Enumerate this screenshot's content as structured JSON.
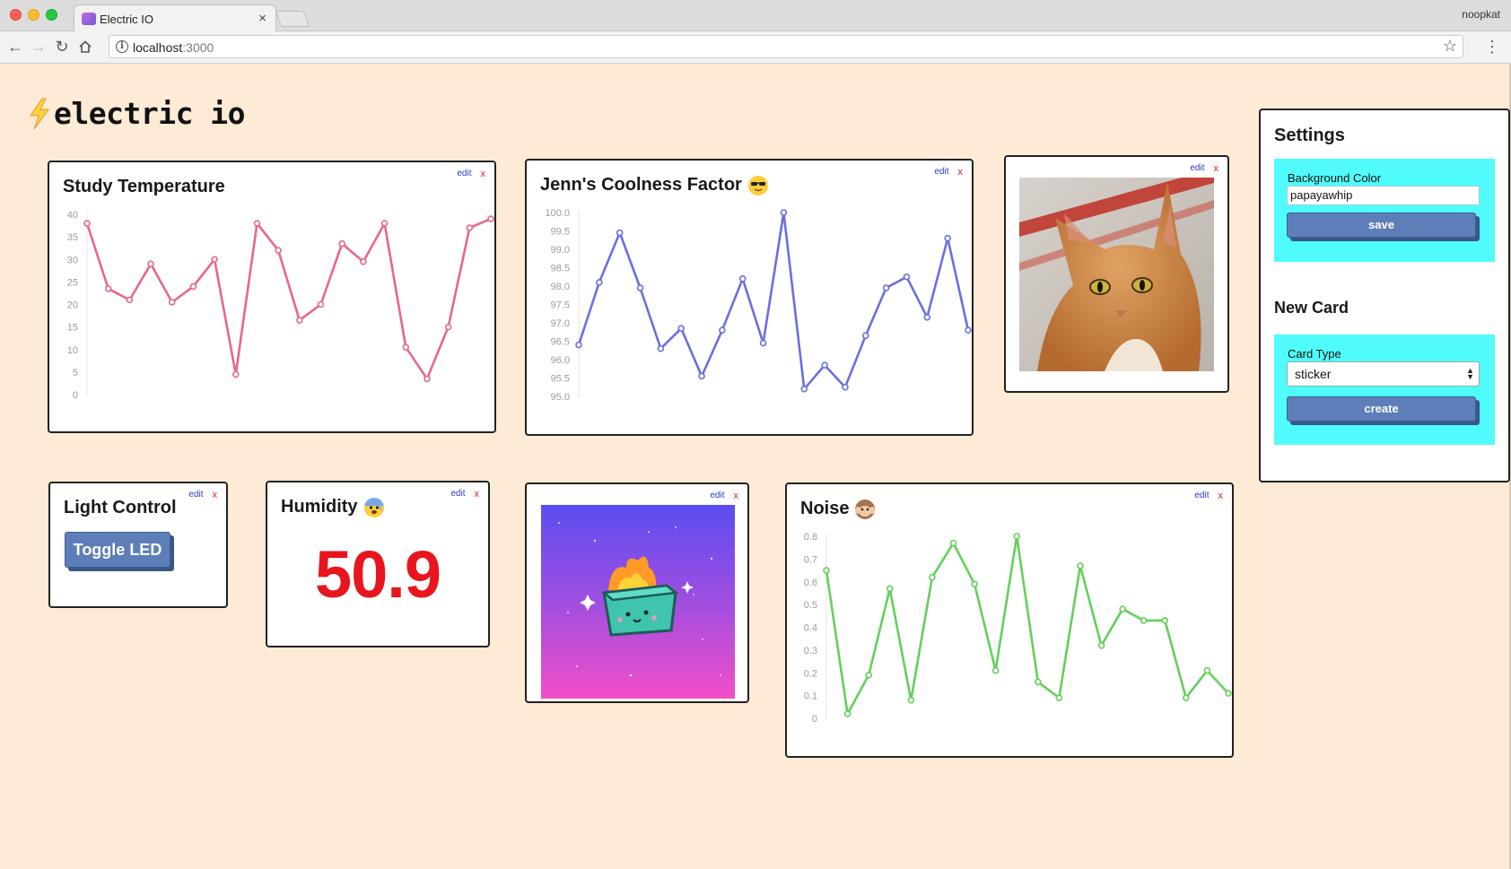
{
  "browser": {
    "tab_title": "Electric IO",
    "profile": "noopkat",
    "url_host": "localhost",
    "url_port": ":3000",
    "tab_close": "×"
  },
  "app": {
    "logo_text": "electric io"
  },
  "card_actions": {
    "edit": "edit",
    "remove": "x"
  },
  "cards": {
    "study_temperature": {
      "title": "Study Temperature"
    },
    "coolness": {
      "title": "Jenn's Coolness Factor"
    },
    "light_control": {
      "title": "Light Control",
      "button": "Toggle LED"
    },
    "humidity": {
      "title": "Humidity",
      "value": "50.9"
    },
    "noise": {
      "title": "Noise"
    }
  },
  "settings": {
    "title": "Settings",
    "bg_label": "Background Color",
    "bg_value": "papayawhip",
    "save": "save",
    "new_card_title": "New Card",
    "card_type_label": "Card Type",
    "card_type_value": "sticker",
    "create": "create"
  },
  "colors": {
    "page_bg": "#fdebd5",
    "temperature_line": "#e8678a",
    "coolness_line": "#6b6fe0",
    "noise_line": "#63d05c",
    "settings_panel": "#4ffcfb",
    "button": "#5d7eb8",
    "humidity_value": "#e8151f"
  },
  "chart_data": [
    {
      "type": "line",
      "title": "Study Temperature",
      "ylim": [
        0,
        40
      ],
      "yticks": [
        "0",
        "5",
        "10",
        "15",
        "20",
        "25",
        "30",
        "35",
        "40"
      ],
      "grid": false,
      "series": [
        {
          "values": [
            38,
            23.5,
            21,
            29,
            20.5,
            24,
            30,
            4.5,
            38,
            32,
            16.5,
            20,
            33.5,
            29.5,
            38,
            10.5,
            3.5,
            15,
            37,
            39
          ]
        }
      ]
    },
    {
      "type": "line",
      "title": "Jenn's Coolness Factor",
      "ylim": [
        95.0,
        100.0
      ],
      "yticks": [
        "95.0",
        "95.5",
        "96.0",
        "96.5",
        "97.0",
        "97.5",
        "98.0",
        "98.5",
        "99.0",
        "99.5",
        "100.0"
      ],
      "grid": false,
      "series": [
        {
          "values": [
            96.4,
            98.1,
            99.45,
            97.95,
            96.3,
            96.85,
            95.55,
            96.8,
            98.2,
            96.45,
            100.0,
            95.2,
            95.85,
            95.25,
            96.65,
            97.95,
            98.25,
            97.15,
            99.3,
            96.8
          ]
        }
      ]
    },
    {
      "type": "line",
      "title": "Noise",
      "ylim": [
        0,
        0.8
      ],
      "yticks": [
        "0",
        "0.1",
        "0.2",
        "0.3",
        "0.4",
        "0.5",
        "0.6",
        "0.7",
        "0.8"
      ],
      "grid": false,
      "series": [
        {
          "values": [
            0.65,
            0.02,
            0.19,
            0.57,
            0.08,
            0.62,
            0.77,
            0.59,
            0.21,
            0.8,
            0.16,
            0.09,
            0.67,
            0.32,
            0.48,
            0.43,
            0.43,
            0.09,
            0.21,
            0.11
          ]
        }
      ]
    }
  ]
}
